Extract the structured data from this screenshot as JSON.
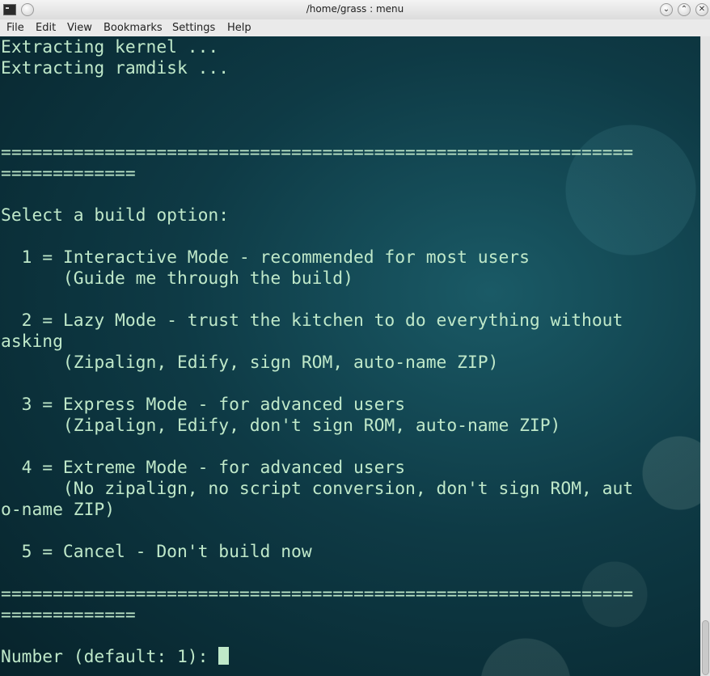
{
  "window": {
    "title": "/home/grass : menu"
  },
  "menu": [
    "File",
    "Edit",
    "View",
    "Bookmarks",
    "Settings",
    "Help"
  ],
  "terminal": {
    "lines": [
      "Extracting kernel ...",
      "Extracting ramdisk ...",
      "",
      "",
      "",
      "=============================================================",
      "=============",
      "",
      "Select a build option:",
      "",
      "  1 = Interactive Mode - recommended for most users",
      "      (Guide me through the build)",
      "",
      "  2 = Lazy Mode - trust the kitchen to do everything without",
      "asking",
      "      (Zipalign, Edify, sign ROM, auto-name ZIP)",
      "",
      "  3 = Express Mode - for advanced users",
      "      (Zipalign, Edify, don't sign ROM, auto-name ZIP)",
      "",
      "  4 = Extreme Mode - for advanced users",
      "      (No zipalign, no script conversion, don't sign ROM, aut",
      "o-name ZIP)",
      "",
      "  5 = Cancel - Don't build now",
      "",
      "=============================================================",
      "=============",
      "",
      "Number (default: 1): "
    ]
  },
  "colors": {
    "text": "#bfe8c9",
    "background": "#0e3a45"
  }
}
